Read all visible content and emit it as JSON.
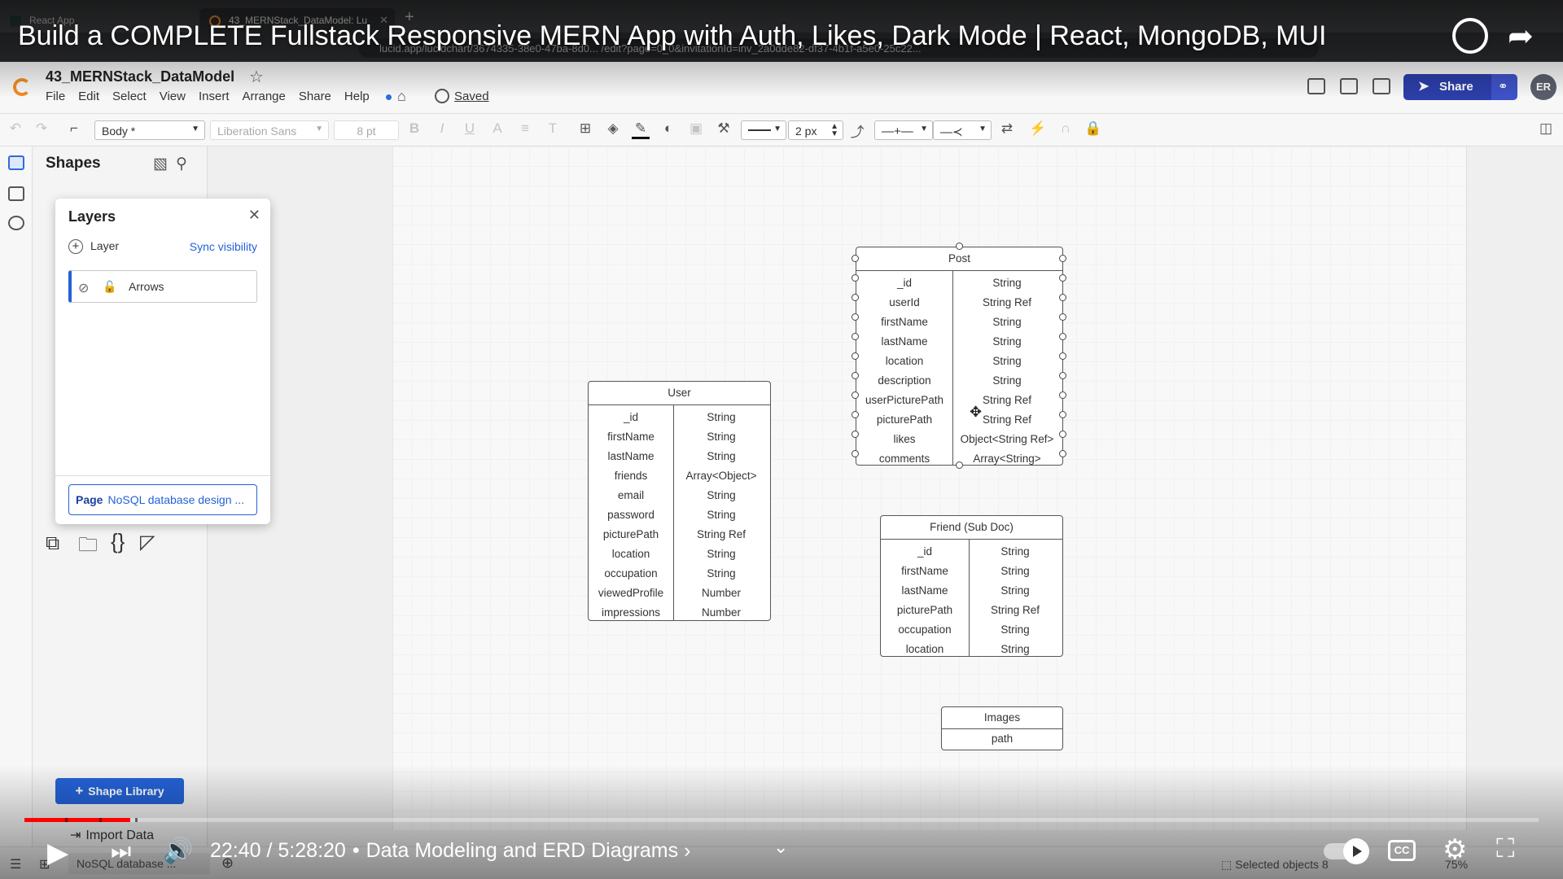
{
  "browser": {
    "tabs": [
      {
        "label": "React App"
      },
      {
        "label": "43_MERNStack_DataModel: Lu"
      }
    ],
    "url": "lucid.app/lucidchart/3674335-38e0-47ba-8d0... /edit?page=0_0&invitationId=inv_2a0dde82-df37-4b1f-a5e0-25c22... "
  },
  "video": {
    "title": "Build a COMPLETE Fullstack Responsive MERN App with Auth, Likes, Dark Mode | React, MongoDB, MUI",
    "time_current": "22:40",
    "time_total": "5:28:20",
    "chapter": "Data Modeling and ERD Diagrams",
    "progress_percent": 7,
    "cc_label": "CC"
  },
  "app": {
    "doc_name": "43_MERNStack_DataModel",
    "menu": [
      "File",
      "Edit",
      "Select",
      "View",
      "Insert",
      "Arrange",
      "Share",
      "Help"
    ],
    "saved_label": "Saved",
    "share_label": "Share",
    "avatar_initials": "ER",
    "accent_color": "#2462d6"
  },
  "toolbar": {
    "style_select": "Body *",
    "font_select": "Liberation Sans",
    "font_size": "8 pt",
    "line_width": "2 px"
  },
  "shapes_panel": {
    "title": "Shapes",
    "shape_library_label": "Shape Library",
    "import_label": "Import Data"
  },
  "layers": {
    "title": "Layers",
    "add_layer_label": "Layer",
    "sync_label": "Sync visibility",
    "items": [
      {
        "name": "Arrows"
      }
    ],
    "page_tag": "Page",
    "page_name": "NoSQL database design ..."
  },
  "tables": {
    "user": {
      "title": "User",
      "rows": [
        {
          "k": "_id",
          "v": "String"
        },
        {
          "k": "firstName",
          "v": "String"
        },
        {
          "k": "lastName",
          "v": "String"
        },
        {
          "k": "friends",
          "v": "Array<Object>"
        },
        {
          "k": "email",
          "v": "String"
        },
        {
          "k": "password",
          "v": "String"
        },
        {
          "k": "picturePath",
          "v": "String Ref"
        },
        {
          "k": "location",
          "v": "String"
        },
        {
          "k": "occupation",
          "v": "String"
        },
        {
          "k": "viewedProfile",
          "v": "Number"
        },
        {
          "k": "impressions",
          "v": "Number"
        }
      ]
    },
    "post": {
      "title": "Post",
      "rows": [
        {
          "k": "_id",
          "v": "String"
        },
        {
          "k": "userId",
          "v": "String Ref"
        },
        {
          "k": "firstName",
          "v": "String"
        },
        {
          "k": "lastName",
          "v": "String"
        },
        {
          "k": "location",
          "v": "String"
        },
        {
          "k": "description",
          "v": "String"
        },
        {
          "k": "userPicturePath",
          "v": "String Ref"
        },
        {
          "k": "picturePath",
          "v": "String Ref"
        },
        {
          "k": "likes",
          "v": "Object<String Ref>"
        },
        {
          "k": "comments",
          "v": "Array<String>"
        }
      ]
    },
    "friend": {
      "title": "Friend (Sub Doc)",
      "rows": [
        {
          "k": "_id",
          "v": "String"
        },
        {
          "k": "firstName",
          "v": "String"
        },
        {
          "k": "lastName",
          "v": "String"
        },
        {
          "k": "picturePath",
          "v": "String Ref"
        },
        {
          "k": "occupation",
          "v": "String"
        },
        {
          "k": "location",
          "v": "String"
        }
      ]
    },
    "images": {
      "title": "Images",
      "rows": [
        {
          "k": "path"
        }
      ]
    }
  },
  "statusbar": {
    "page_label": "NoSQL database ...",
    "selected_label": "Selected objects",
    "selected_count": "8",
    "zoom": "75%"
  }
}
